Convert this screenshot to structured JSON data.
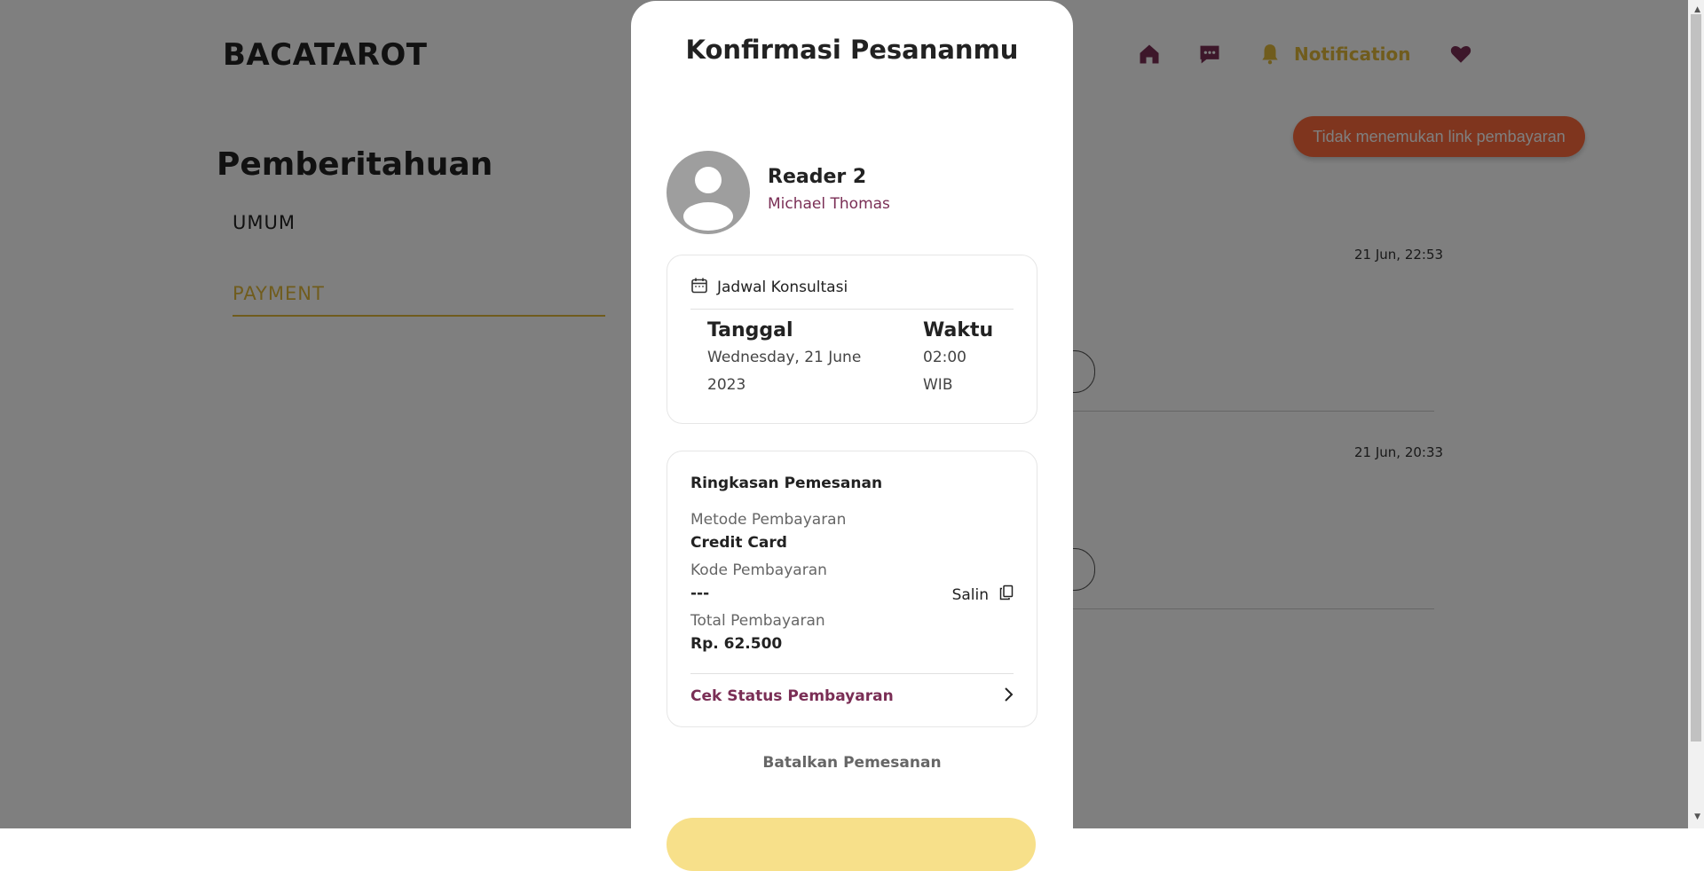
{
  "header": {
    "brand": "BACATAROT",
    "nav": {
      "notification_label": "Notification"
    }
  },
  "colors": {
    "accent_gold": "#E0B93A",
    "brand_maroon": "#7A2E55",
    "alert_orange": "#FF6B3D",
    "overlay": "rgba(0,0,0,0.5)"
  },
  "alert_button": {
    "label": "Tidak menemukan link pembayaran"
  },
  "page": {
    "heading": "Pemberitahuan",
    "tabs": [
      {
        "label": "UMUM",
        "active": false
      },
      {
        "label": "PAYMENT",
        "active": true
      }
    ],
    "notifications": [
      {
        "time": "21 Jun, 22:53"
      },
      {
        "time": "21 Jun, 20:33"
      }
    ]
  },
  "modal": {
    "title": "Konfirmasi Pesananmu",
    "reader": {
      "name": "Reader 2",
      "subtitle": "Michael Thomas"
    },
    "schedule": {
      "heading": "Jadwal Konsultasi",
      "date_title": "Tanggal",
      "date_line1": "Wednesday, 21 June",
      "date_line2": "2023",
      "time_title": "Waktu",
      "time_line1": "02:00",
      "time_line2": "WIB"
    },
    "summary": {
      "title": "Ringkasan Pemesanan",
      "method_label": "Metode Pembayaran",
      "method_value": "Credit Card",
      "code_label": "Kode Pembayaran",
      "code_value": "---",
      "copy_label": "Salin",
      "total_label": "Total Pembayaran",
      "total_value": "Rp. 62.500",
      "check_status_label": "Cek Status Pembayaran"
    },
    "cancel_label": "Batalkan Pemesanan"
  },
  "icons": [
    "home-icon",
    "chat-icon",
    "bell-icon",
    "heart-icon",
    "calendar-icon",
    "copy-icon",
    "chevron-right-icon",
    "user-avatar-icon"
  ]
}
